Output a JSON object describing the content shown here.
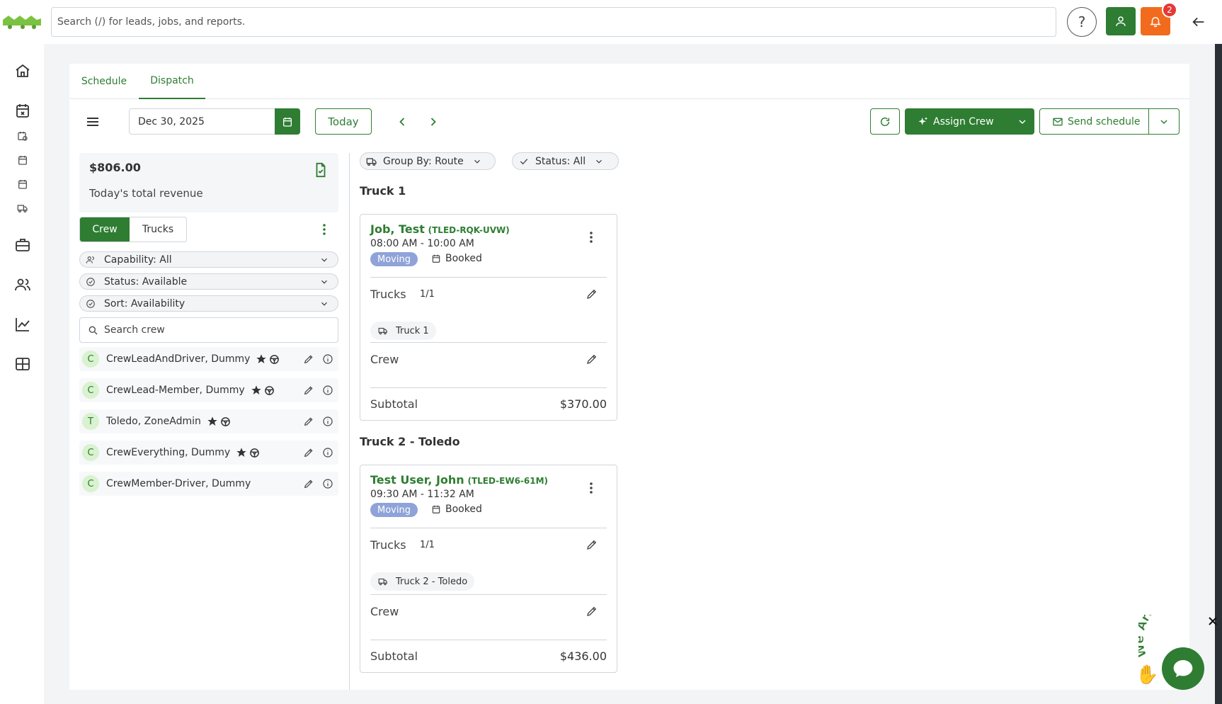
{
  "search": {
    "placeholder": "Search (/) for leads, jobs, and reports."
  },
  "header": {
    "help_label": "?",
    "notification_count": "2"
  },
  "tabs": [
    {
      "label": "Schedule",
      "active": false
    },
    {
      "label": "Dispatch",
      "active": true
    }
  ],
  "toolbar": {
    "date": "Dec 30, 2025",
    "today_label": "Today",
    "assign_crew_label": "Assign Crew",
    "send_schedule_label": "Send schedule"
  },
  "revenue": {
    "amount": "$806.00",
    "label": "Today's total revenue"
  },
  "crew_panel": {
    "toggle": [
      "Crew",
      "Trucks"
    ],
    "active_toggle": "Crew",
    "filters": [
      {
        "label": "Capability: All",
        "icon": "users-icon"
      },
      {
        "label": "Status: Available",
        "icon": "check-circle-icon"
      },
      {
        "label": "Sort: Availability",
        "icon": "check-circle-icon"
      }
    ],
    "search_placeholder": "Search crew",
    "members": [
      {
        "initial": "C",
        "name": "CrewLeadAndDriver, Dummy"
      },
      {
        "initial": "C",
        "name": "CrewLead-Member, Dummy"
      },
      {
        "initial": "T",
        "name": "Toledo, ZoneAdmin"
      },
      {
        "initial": "C",
        "name": "CrewEverything, Dummy"
      },
      {
        "initial": "C",
        "name": "CrewMember-Driver, Dummy"
      }
    ]
  },
  "dispatch": {
    "group_by_label": "Group By: Route",
    "status_label": "Status: All",
    "groups": [
      {
        "name": "Truck 1",
        "job": {
          "customer": "Job, Test",
          "code": "(TLED-RQK-UVW)",
          "time": "08:00 AM - 10:00 AM",
          "type": "Moving",
          "status": "Booked",
          "trucks_label": "Trucks",
          "trucks_count": "1/1",
          "truck": "Truck 1",
          "crew_label": "Crew",
          "subtotal_label": "Subtotal",
          "subtotal": "$370.00"
        }
      },
      {
        "name": "Truck 2 - Toledo",
        "job": {
          "customer": "Test User, John",
          "code": "(TLED-EW6-61M)",
          "time": "09:30 AM - 11:32 AM",
          "type": "Moving",
          "status": "Booked",
          "trucks_label": "Trucks",
          "trucks_count": "1/1",
          "truck": "Truck 2 - Toledo",
          "crew_label": "Crew",
          "subtotal_label": "Subtotal",
          "subtotal": "$436.00"
        }
      }
    ]
  },
  "chat": {
    "text": "We Are Here!"
  },
  "colors": {
    "brand": "#2e7d32",
    "notify": "#f26b1d",
    "badge": "#e53935",
    "moving_tag": "#8fa3d9"
  }
}
